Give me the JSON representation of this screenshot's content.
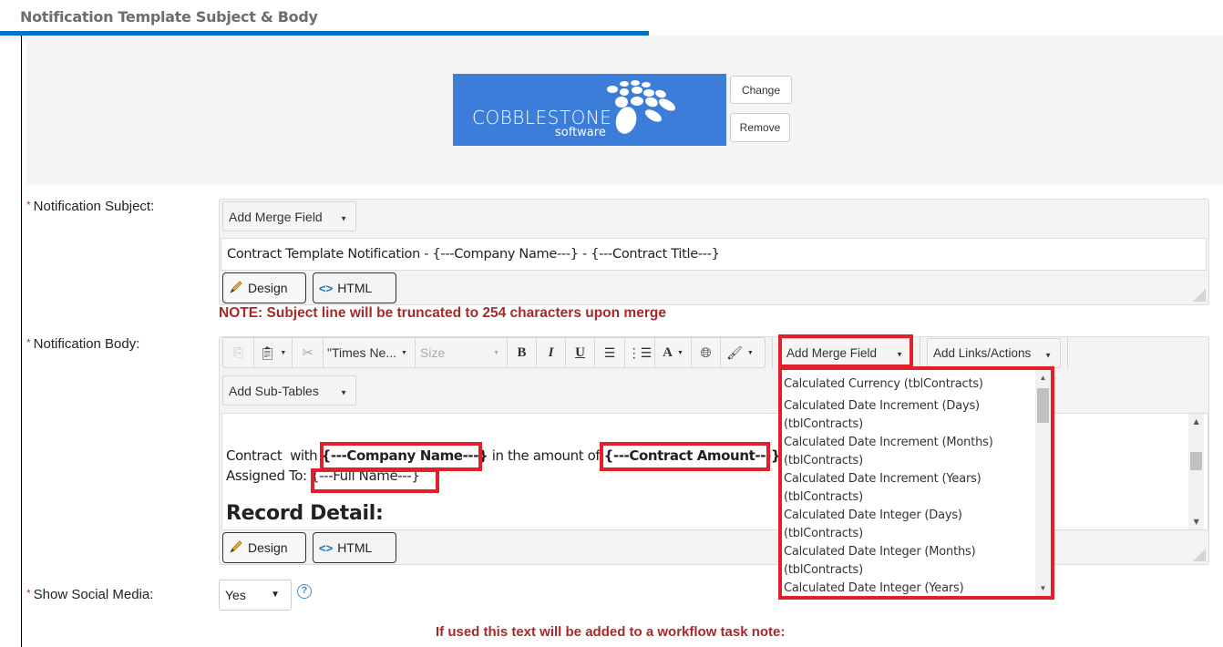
{
  "header": {
    "title": "Notification Template Subject & Body"
  },
  "logo": {
    "wordmark": "COBBLESTONE",
    "subtitle": "software",
    "change_label": "Change",
    "remove_label": "Remove",
    "brand_color": "#3b7dd8"
  },
  "subject": {
    "label": "Notification Subject:",
    "required_mark": "*",
    "add_merge_field_label": "Add Merge Field",
    "value": "Contract Template Notification - {---Company Name---} - {---Contract Title---}",
    "design_label": "Design",
    "html_label": "HTML",
    "note": "NOTE: Subject line will be truncated to 254 characters upon merge"
  },
  "body": {
    "label": "Notification Body:",
    "required_mark": "*",
    "toolbar": {
      "font_family": "\"Times Ne...",
      "font_size_placeholder": "Size",
      "bold": "B",
      "italic": "I",
      "underline": "U",
      "font_color": "A",
      "add_merge_field_label": "Add Merge Field",
      "add_links_label": "Add Links/Actions",
      "add_subtables_label": "Add Sub-Tables"
    },
    "content": {
      "line1_prefix": "Contract  with ",
      "company_field": "{---Company Name---}",
      "line1_mid": " in the amount of ",
      "amount_field": "{---Contract Amount---}",
      "line2_prefix": "Assigned To: ",
      "fullname_field": "{---Full Name---}",
      "heading": "Record Detail:"
    },
    "design_label": "Design",
    "html_label": "HTML",
    "merge_field_options": [
      "Calculated Currency (tblContracts)",
      "Calculated Date Increment (Days) (tblContracts)",
      "Calculated Date Increment (Months) (tblContracts)",
      "Calculated Date Increment (Years) (tblContracts)",
      "Calculated Date Integer (Days) (tblContracts)",
      "Calculated Date Integer (Months) (tblContracts)",
      "Calculated Date Integer (Years)"
    ],
    "highlight_color": "#e0202a"
  },
  "social": {
    "label": "Show Social Media:",
    "required_mark": "*",
    "value": "Yes",
    "help": "?"
  },
  "workflow_note": "If used this text will be added to a workflow task note:"
}
